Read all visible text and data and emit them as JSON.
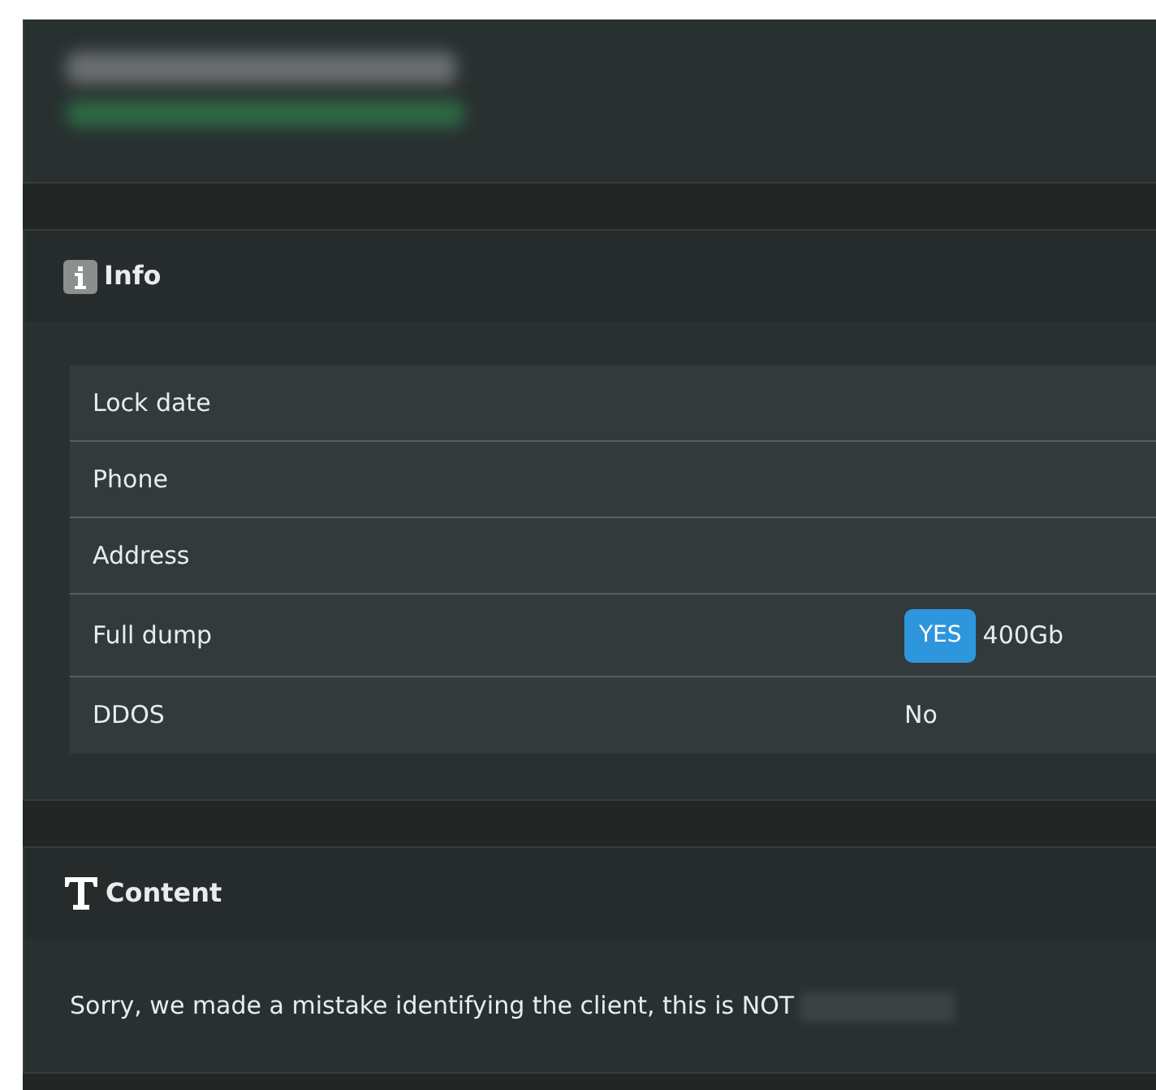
{
  "info": {
    "title": "Info",
    "rows": [
      {
        "label": "Lock date"
      },
      {
        "label": "Phone"
      },
      {
        "label": "Address"
      },
      {
        "label": "Full dump",
        "badge": "YES",
        "value": "400Gb"
      },
      {
        "label": "DDOS",
        "value": "No"
      }
    ]
  },
  "content": {
    "title": "Content",
    "text": "Sorry, we made a mistake identifying the client, this is NOT"
  }
}
